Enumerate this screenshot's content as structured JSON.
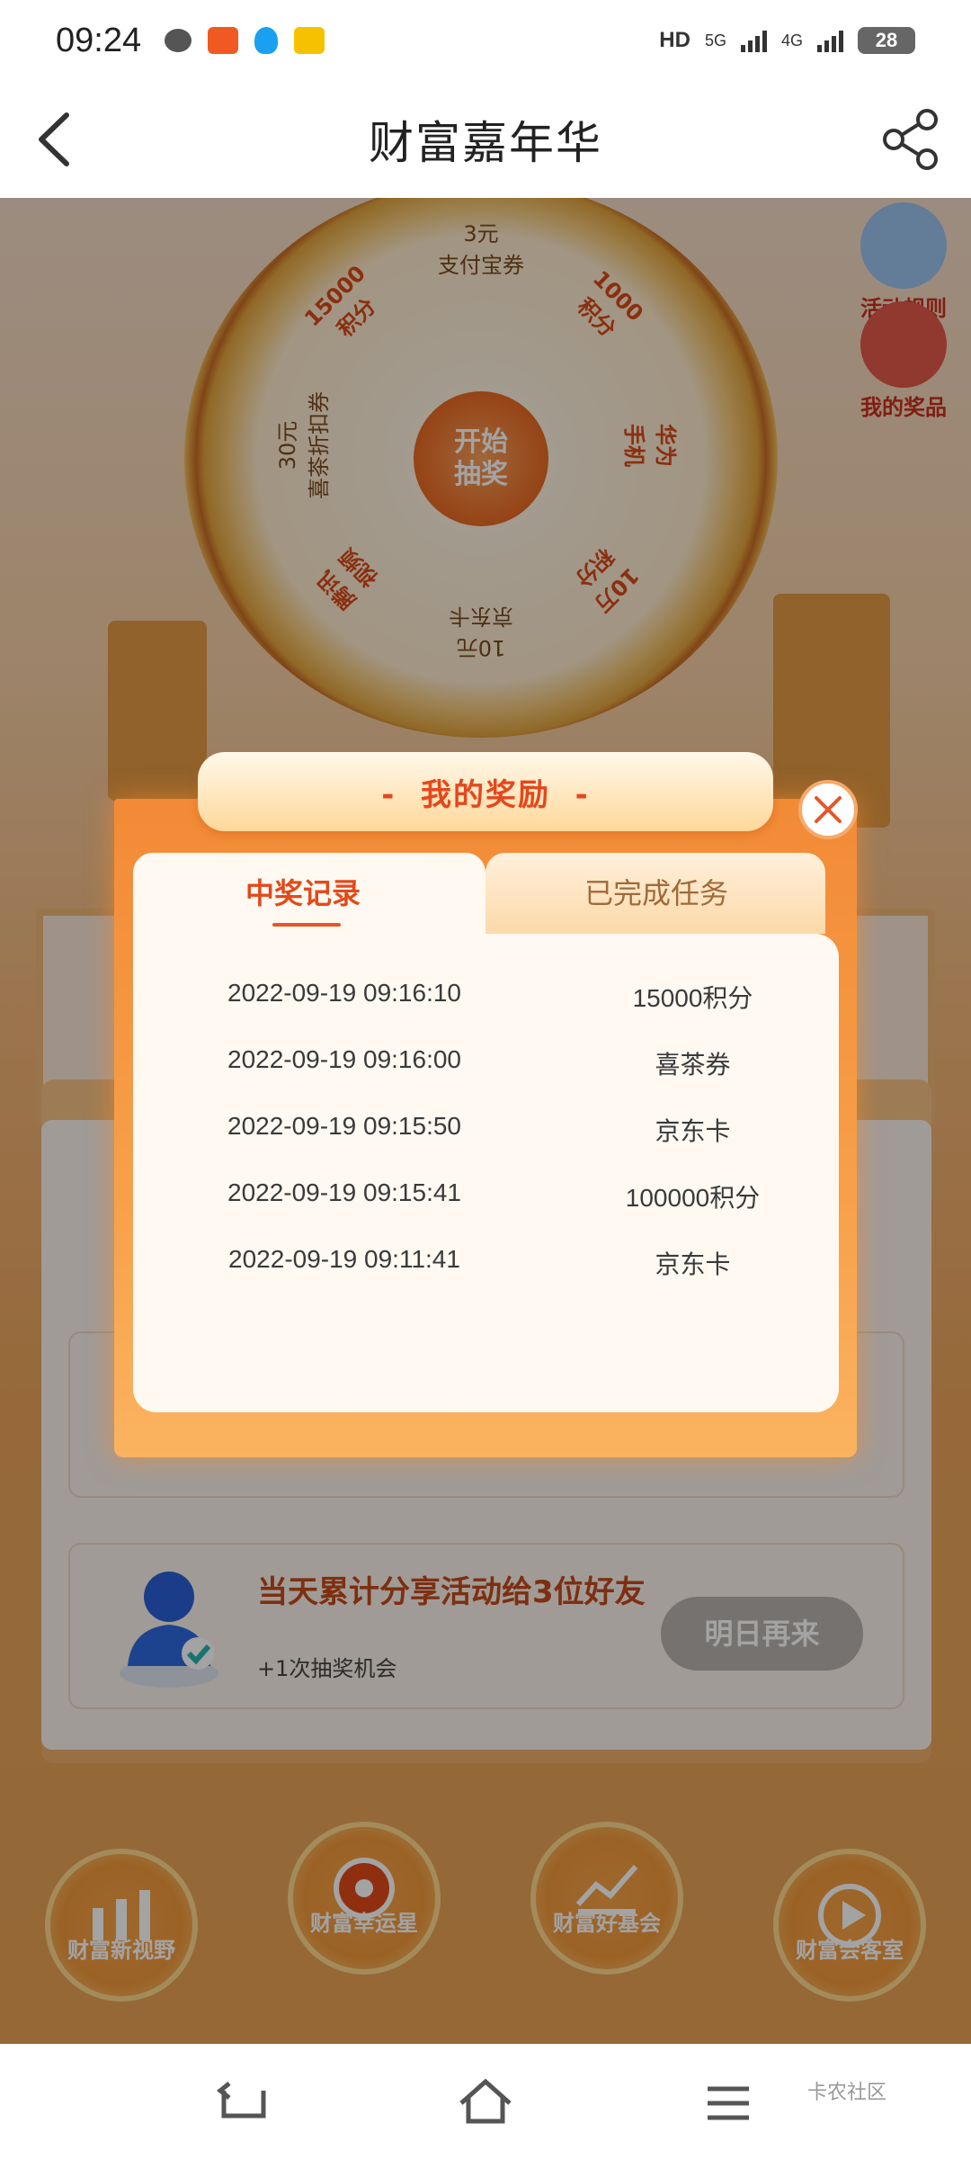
{
  "status_bar": {
    "time": "09:24",
    "hd": "HD",
    "net1": "5G",
    "net2": "4G",
    "battery": "28"
  },
  "header": {
    "title": "财富嘉年华"
  },
  "background": {
    "wheel_center": "开始\n抽奖",
    "wheel_labels": [
      "3元\n支付宝券",
      "1000\n积分",
      "华为\n手机",
      "10万\n积分",
      "10元\n京东卡",
      "腾讯\n视频",
      "30元\n喜茶折扣券",
      "15000\n积分"
    ],
    "side_rules": "活动规则",
    "side_prizes": "我的奖品",
    "task_title": "当天累计分享活动给3位好友",
    "task_sub": "+1次抽奖机会",
    "task_button": "明日再来",
    "nav": [
      "财富新视野",
      "财富幸运星",
      "财富好基会",
      "财富会客室"
    ]
  },
  "modal": {
    "title": "-  我的奖励  -",
    "tabs": {
      "records": "中奖记录",
      "tasks": "已完成任务"
    },
    "records": [
      {
        "time": "2022-09-19 09:16:10",
        "prize": "15000积分"
      },
      {
        "time": "2022-09-19 09:16:00",
        "prize": "喜茶券"
      },
      {
        "time": "2022-09-19 09:15:50",
        "prize": "京东卡"
      },
      {
        "time": "2022-09-19 09:15:41",
        "prize": "100000积分"
      },
      {
        "time": "2022-09-19 09:11:41",
        "prize": "京东卡"
      }
    ]
  },
  "watermark": "卡农社区"
}
